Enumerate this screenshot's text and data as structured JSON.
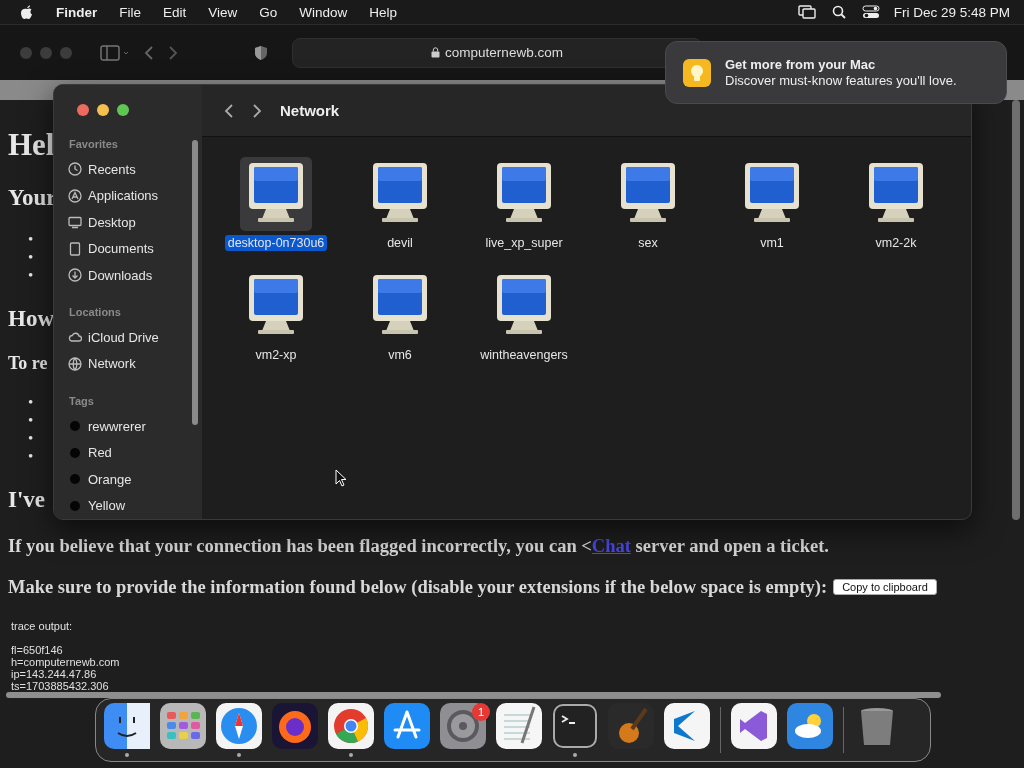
{
  "menu_bar": {
    "app_name": "Finder",
    "menus": [
      "File",
      "Edit",
      "View",
      "Go",
      "Window",
      "Help"
    ],
    "clock": "Fri Dec 29  5:48 PM"
  },
  "browser": {
    "address": "computernewb.com",
    "blocks": [
      {
        "kind": "h1",
        "text": "Hel"
      },
      {
        "kind": "h2",
        "text": "Your"
      },
      {
        "kind": "list",
        "items": [
          "•",
          "•",
          "•"
        ]
      },
      {
        "kind": "h2",
        "text": "How"
      },
      {
        "kind": "p",
        "text": "To re"
      },
      {
        "kind": "list",
        "items": [
          "•",
          "•",
          "•",
          "•"
        ]
      },
      {
        "kind": "h2",
        "text": "I've"
      }
    ],
    "notice": {
      "before": "If you believe that your connection has been flagged incorrectly, you can <",
      "link": "Chat",
      "after": " server and open a ticket."
    },
    "instruction": "Make sure to provide the information found below (disable your extensions if the below space is empty):",
    "copy_button": "Copy to clipboard",
    "trace_title": "trace output:",
    "trace_lines": [
      "fl=650f146",
      "h=computernewb.com",
      "ip=143.244.47.86",
      "ts=1703885432.306"
    ]
  },
  "finder": {
    "title": "Network",
    "sidebar": [
      {
        "heading": "Favorites",
        "items": [
          {
            "label": "Recents",
            "kind": "clock"
          },
          {
            "label": "Applications",
            "kind": "apps"
          },
          {
            "label": "Desktop",
            "kind": "desktop"
          },
          {
            "label": "Documents",
            "kind": "doc"
          },
          {
            "label": "Downloads",
            "kind": "download"
          }
        ]
      },
      {
        "heading": "Locations",
        "items": [
          {
            "label": "iCloud Drive",
            "kind": "cloud"
          },
          {
            "label": "Network",
            "kind": "globe"
          }
        ]
      },
      {
        "heading": "Tags",
        "items": [
          {
            "label": "rewwrerer",
            "kind": "tag"
          },
          {
            "label": "Red",
            "kind": "tag"
          },
          {
            "label": "Orange",
            "kind": "tag"
          },
          {
            "label": "Yellow",
            "kind": "tag"
          }
        ]
      }
    ],
    "files": [
      {
        "name": "desktop-0n730u6",
        "selected": true
      },
      {
        "name": "devil",
        "selected": false
      },
      {
        "name": "live_xp_super",
        "selected": false
      },
      {
        "name": "sex",
        "selected": false
      },
      {
        "name": "vm1",
        "selected": false
      },
      {
        "name": "vm2-2k",
        "selected": false
      },
      {
        "name": "vm2-xp",
        "selected": false
      },
      {
        "name": "vm6",
        "selected": false
      },
      {
        "name": "wintheavengers",
        "selected": false
      }
    ]
  },
  "notification": {
    "title": "Get more from your Mac",
    "body": "Discover must-know features you'll love."
  },
  "dock": [
    {
      "kind": "finder",
      "running": true
    },
    {
      "kind": "launchpad",
      "running": false
    },
    {
      "kind": "safari",
      "running": true
    },
    {
      "kind": "firefox",
      "running": false
    },
    {
      "kind": "chrome",
      "running": true
    },
    {
      "kind": "appstore",
      "running": false
    },
    {
      "kind": "settings",
      "running": false,
      "badge": "1"
    },
    {
      "kind": "textedit",
      "running": false
    },
    {
      "kind": "terminal",
      "running": true
    },
    {
      "kind": "garageband",
      "running": false
    },
    {
      "kind": "vscode",
      "running": false
    },
    {
      "kind": "divider"
    },
    {
      "kind": "vs",
      "running": false
    },
    {
      "kind": "weather",
      "running": false
    },
    {
      "kind": "divider"
    },
    {
      "kind": "trash",
      "running": false
    }
  ]
}
